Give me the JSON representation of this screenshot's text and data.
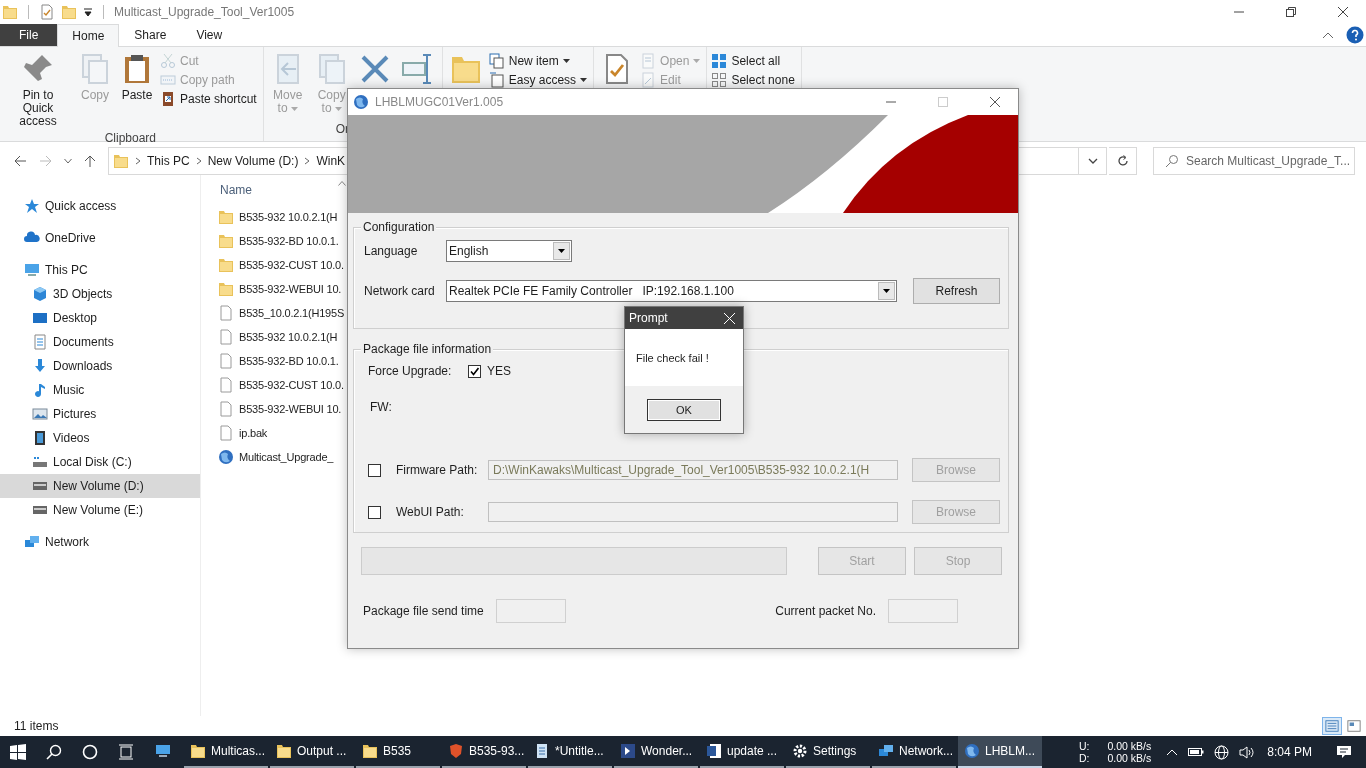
{
  "explorer": {
    "title": "Multicast_Upgrade_Tool_Ver1005",
    "ribbon_tabs": [
      {
        "label": "File",
        "selected": false,
        "kind": "file"
      },
      {
        "label": "Home",
        "selected": true,
        "kind": "tab"
      },
      {
        "label": "Share",
        "selected": false,
        "kind": "tab"
      },
      {
        "label": "View",
        "selected": false,
        "kind": "tab"
      }
    ],
    "ribbon_groups": [
      {
        "label": "Clipboard",
        "large": [
          {
            "kind": "pin",
            "label": "Pin to Quick access",
            "disabled": false
          },
          {
            "kind": "copy",
            "label": "Copy",
            "disabled": true
          },
          {
            "kind": "paste",
            "label": "Paste",
            "disabled": false
          }
        ],
        "small": [
          {
            "kind": "cut",
            "label": "Cut",
            "disabled": true
          },
          {
            "kind": "copypath",
            "label": "Copy path",
            "disabled": true
          },
          {
            "kind": "shortcut",
            "label": "Paste shortcut",
            "disabled": false
          }
        ]
      },
      {
        "label": "Or",
        "large": [
          {
            "kind": "move",
            "label": "Move to",
            "menu": true,
            "disabled": true
          },
          {
            "kind": "copyto",
            "label": "Copy to",
            "menu": true,
            "disabled": true
          },
          {
            "kind": "delete",
            "disabled": false
          },
          {
            "kind": "rename",
            "disabled": false
          }
        ]
      },
      {
        "large": [
          {
            "kind": "newfolder",
            "disabled": false
          }
        ],
        "small": [
          {
            "kind": "newitem",
            "label": "New item",
            "menu": true,
            "disabled": false
          },
          {
            "kind": "easyaccess",
            "label": "Easy access",
            "menu": true,
            "disabled": false
          }
        ]
      },
      {
        "large": [
          {
            "kind": "properties",
            "disabled": false
          }
        ],
        "small": [
          {
            "kind": "open",
            "label": "Open",
            "menu": true,
            "disabled": true
          },
          {
            "kind": "edit",
            "label": "Edit",
            "disabled": true
          }
        ]
      },
      {
        "small": [
          {
            "kind": "selectall",
            "label": "Select all",
            "disabled": false
          },
          {
            "kind": "selectnone",
            "label": "Select none",
            "disabled": false
          }
        ]
      }
    ],
    "breadcrumbs": [
      "This PC",
      "New Volume (D:)",
      "WinK"
    ],
    "search": {
      "placeholder": "Search Multicast_Upgrade_T..."
    },
    "navigation": [
      {
        "label": "Quick access",
        "kind": "star",
        "selected": false
      },
      {
        "label": "OneDrive",
        "kind": "cloud",
        "selected": false
      },
      {
        "label": "This PC",
        "kind": "pc",
        "selected": false,
        "children": [
          {
            "label": "3D Objects",
            "kind": "cube",
            "selected": false
          },
          {
            "label": "Desktop",
            "kind": "desktop",
            "selected": false
          },
          {
            "label": "Documents",
            "kind": "documents",
            "selected": false
          },
          {
            "label": "Downloads",
            "kind": "download",
            "selected": false
          },
          {
            "label": "Music",
            "kind": "music",
            "selected": false
          },
          {
            "label": "Pictures",
            "kind": "pictures",
            "selected": false
          },
          {
            "label": "Videos",
            "kind": "videos",
            "selected": false
          },
          {
            "label": "Local Disk (C:)",
            "kind": "disk",
            "selected": false
          },
          {
            "label": "New Volume (D:)",
            "kind": "drive",
            "selected": true
          },
          {
            "label": "New Volume (E:)",
            "kind": "drive",
            "selected": false
          }
        ]
      },
      {
        "label": "Network",
        "kind": "network",
        "selected": false
      }
    ],
    "column_header": "Name",
    "files": [
      {
        "name": "B535-932 10.0.2.1(H",
        "kind": "folder"
      },
      {
        "name": "B535-932-BD 10.0.1.",
        "kind": "folder"
      },
      {
        "name": "B535-932-CUST 10.0.",
        "kind": "folder"
      },
      {
        "name": "B535-932-WEBUI 10.",
        "kind": "folder"
      },
      {
        "name": "B535_10.0.2.1(H195S",
        "kind": "file"
      },
      {
        "name": "B535-932 10.0.2.1(H",
        "kind": "file"
      },
      {
        "name": "B535-932-BD 10.0.1.",
        "kind": "file"
      },
      {
        "name": "B535-932-CUST 10.0.",
        "kind": "file"
      },
      {
        "name": "B535-932-WEBUI 10.",
        "kind": "file"
      },
      {
        "name": "ip.bak",
        "kind": "file"
      },
      {
        "name": "Multicast_Upgrade_",
        "kind": "globe"
      }
    ],
    "status_bar": {
      "count": "11 items",
      "views": [
        {
          "kind": "details",
          "selected": true
        },
        {
          "kind": "tiles",
          "selected": false
        }
      ]
    }
  },
  "app": {
    "title": "LHBLMUGC01Ver1.005",
    "configuration": {
      "title": "Configuration",
      "language": {
        "label": "Language",
        "value": "English"
      },
      "network_card": {
        "label": "Network card",
        "value": "Realtek PCIe FE Family Controller   IP:192.168.1.100"
      },
      "refresh": "Refresh"
    },
    "package": {
      "title": "Package file information",
      "force_upgrade": {
        "label": "Force Upgrade:",
        "checked": true,
        "option": "YES"
      },
      "fw_label": "FW:",
      "paths": [
        {
          "label": "Firmware Path:",
          "checked": false,
          "value": "D:\\WinKawaks\\Multicast_Upgrade_Tool_Ver1005\\B535-932 10.0.2.1(H",
          "browse": "Browse",
          "browse_disabled": true
        },
        {
          "label": "WebUI Path:",
          "checked": false,
          "browse": "Browse",
          "browse_disabled": true
        }
      ]
    },
    "progress": {
      "level": 0
    },
    "start": {
      "label": "Start",
      "disabled": true
    },
    "stop": {
      "label": "Stop",
      "disabled": true
    },
    "send_time": {
      "label": "Package file send time"
    },
    "packet_no": {
      "label": "Current packet No."
    }
  },
  "prompt": {
    "title": "Prompt",
    "message": "File check fail !",
    "button": "OK"
  },
  "taskbar": {
    "items": [
      {
        "kind": "monitor",
        "selected": false
      },
      {
        "kind": "folder",
        "label": "Multicas...",
        "selected": false
      },
      {
        "kind": "folder",
        "label": "Output ...",
        "selected": false
      },
      {
        "kind": "folder",
        "label": "B535",
        "selected": false
      },
      {
        "kind": "shield",
        "label": "B535-93...",
        "selected": false
      },
      {
        "kind": "notepad",
        "label": "*Untitle...",
        "selected": false
      },
      {
        "kind": "arrow",
        "label": "Wonder...",
        "selected": false
      },
      {
        "kind": "word",
        "label": "update ...",
        "selected": false
      },
      {
        "kind": "gear",
        "label": "Settings",
        "selected": false
      },
      {
        "kind": "network",
        "label": "Network...",
        "selected": false
      },
      {
        "kind": "globe",
        "label": "LHBLM...",
        "selected": true
      }
    ],
    "net_labels": [
      "U:",
      "D:"
    ],
    "net_values": [
      "0.00 kB/s",
      "0.00 kB/s"
    ],
    "clock": "8:04 PM"
  }
}
